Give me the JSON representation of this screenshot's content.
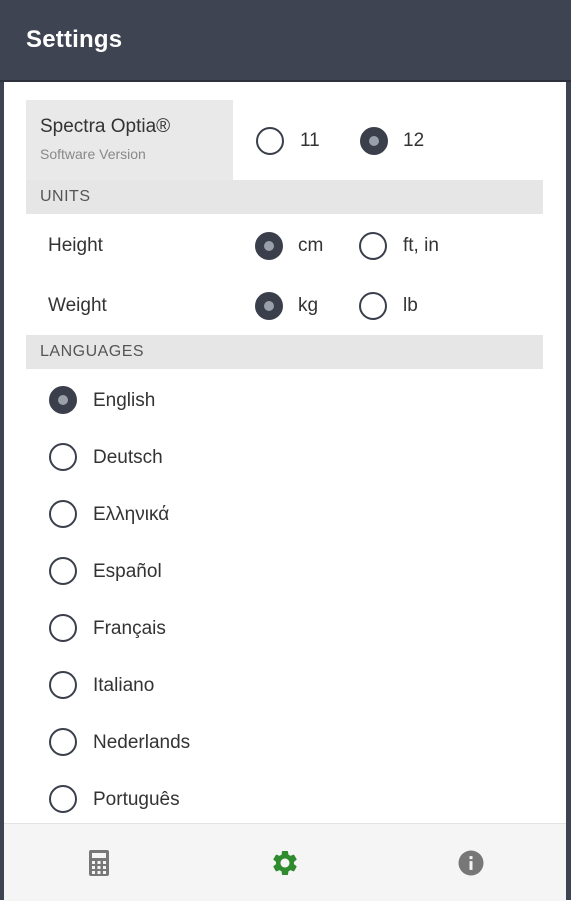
{
  "header": {
    "title": "Settings"
  },
  "device": {
    "name": "Spectra Optia®",
    "subtitle": "Software Version",
    "versions": [
      {
        "label": "11",
        "selected": false
      },
      {
        "label": "12",
        "selected": true
      }
    ]
  },
  "units": {
    "header": "UNITS",
    "height": {
      "label": "Height",
      "options": [
        {
          "label": "cm",
          "selected": true
        },
        {
          "label": "ft, in",
          "selected": false
        }
      ]
    },
    "weight": {
      "label": "Weight",
      "options": [
        {
          "label": "kg",
          "selected": true
        },
        {
          "label": "lb",
          "selected": false
        }
      ]
    }
  },
  "languages": {
    "header": "LANGUAGES",
    "items": [
      {
        "label": "English",
        "selected": true
      },
      {
        "label": "Deutsch",
        "selected": false
      },
      {
        "label": "Ελληνικά",
        "selected": false
      },
      {
        "label": "Español",
        "selected": false
      },
      {
        "label": "Français",
        "selected": false
      },
      {
        "label": "Italiano",
        "selected": false
      },
      {
        "label": "Nederlands",
        "selected": false
      },
      {
        "label": "Português",
        "selected": false
      }
    ]
  },
  "nav": {
    "items": [
      {
        "icon": "calculator-icon",
        "active": false
      },
      {
        "icon": "gear-icon",
        "active": true
      },
      {
        "icon": "info-icon",
        "active": false
      }
    ],
    "active_color": "#2e8b2e",
    "inactive_color": "#777777"
  },
  "colors": {
    "appbar": "#3e4452",
    "radio": "#3a3f4b",
    "section_bg": "#e6e6e6"
  }
}
